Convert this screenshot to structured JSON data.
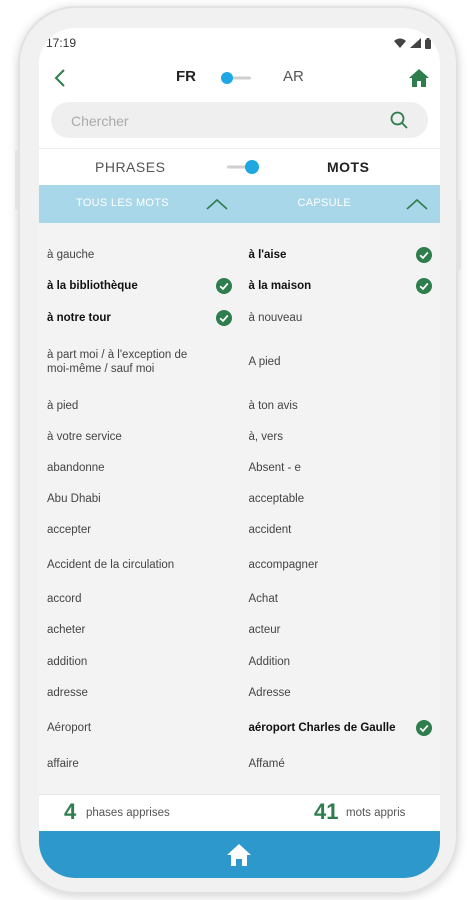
{
  "status": {
    "time": "17:19"
  },
  "header": {
    "lang_left": "FR",
    "lang_right": "AR"
  },
  "search": {
    "placeholder": "Chercher"
  },
  "mode": {
    "left": "PHRASES",
    "right": "MOTS"
  },
  "filters": {
    "left": "TOUS LES MOTS",
    "right": "CAPSULE"
  },
  "words": [
    {
      "left": {
        "text": "à gauche",
        "bold": false,
        "checked": false
      },
      "right": {
        "text": "à l'aise",
        "bold": true,
        "checked": true
      }
    },
    {
      "left": {
        "text": "à la bibliothèque",
        "bold": true,
        "checked": true
      },
      "right": {
        "text": "à la maison",
        "bold": true,
        "checked": true
      }
    },
    {
      "left": {
        "text": "à notre tour",
        "bold": true,
        "checked": true
      },
      "right": {
        "text": "à nouveau",
        "bold": false,
        "checked": false
      }
    },
    {
      "left": {
        "text": "à part moi / à l'exception de moi-même / sauf moi",
        "bold": false,
        "checked": false
      },
      "right": {
        "text": "A pied",
        "bold": false,
        "checked": false
      }
    },
    {
      "left": {
        "text": "à pied",
        "bold": false,
        "checked": false
      },
      "right": {
        "text": "à ton avis",
        "bold": false,
        "checked": false
      }
    },
    {
      "left": {
        "text": "à votre service",
        "bold": false,
        "checked": false
      },
      "right": {
        "text": "à, vers",
        "bold": false,
        "checked": false
      }
    },
    {
      "left": {
        "text": "abandonne",
        "bold": false,
        "checked": false
      },
      "right": {
        "text": "Absent - e",
        "bold": false,
        "checked": false
      }
    },
    {
      "left": {
        "text": "Abu Dhabi",
        "bold": false,
        "checked": false
      },
      "right": {
        "text": "acceptable",
        "bold": false,
        "checked": false
      }
    },
    {
      "left": {
        "text": "accepter",
        "bold": false,
        "checked": false
      },
      "right": {
        "text": "accident",
        "bold": false,
        "checked": false
      }
    },
    {
      "left": {
        "text": "Accident de la circulation",
        "bold": false,
        "checked": false
      },
      "right": {
        "text": "accompagner",
        "bold": false,
        "checked": false
      }
    },
    {
      "left": {
        "text": "accord",
        "bold": false,
        "checked": false
      },
      "right": {
        "text": "Achat",
        "bold": false,
        "checked": false
      }
    },
    {
      "left": {
        "text": "acheter",
        "bold": false,
        "checked": false
      },
      "right": {
        "text": "acteur",
        "bold": false,
        "checked": false
      }
    },
    {
      "left": {
        "text": "addition",
        "bold": false,
        "checked": false
      },
      "right": {
        "text": "Addition",
        "bold": false,
        "checked": false
      }
    },
    {
      "left": {
        "text": "adresse",
        "bold": false,
        "checked": false
      },
      "right": {
        "text": "Adresse",
        "bold": false,
        "checked": false
      }
    },
    {
      "left": {
        "text": "Aéroport",
        "bold": false,
        "checked": false
      },
      "right": {
        "text": "aéroport Charles de Gaulle",
        "bold": true,
        "checked": true
      }
    },
    {
      "left": {
        "text": "affaire",
        "bold": false,
        "checked": false
      },
      "right": {
        "text": "Affamé",
        "bold": false,
        "checked": false
      }
    }
  ],
  "footer": {
    "phrases_count": "4",
    "phrases_label": "phases apprises",
    "words_count": "41",
    "words_label": "mots appris"
  },
  "colors": {
    "accent_blue": "#2c98cc",
    "filter_blue": "#a9d7ea",
    "green": "#2e7d4c",
    "toggle_blue": "#1ea7e1"
  }
}
